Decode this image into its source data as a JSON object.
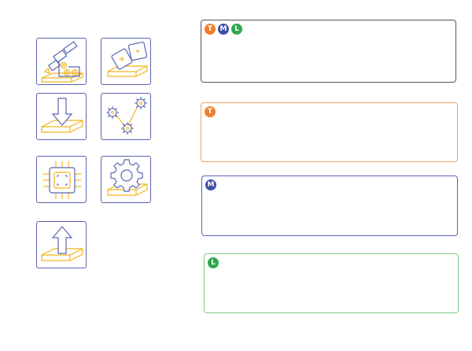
{
  "badges": {
    "t": {
      "letter": "T",
      "color": "#f07d2d"
    },
    "m": {
      "letter": "M",
      "color": "#3e4fa6"
    },
    "l": {
      "letter": "L",
      "color": "#2fa84f"
    }
  },
  "panels": {
    "combined": {
      "border_color": "#555555",
      "badges": [
        "T",
        "M",
        "L"
      ]
    },
    "t": {
      "border_color": "#f0a070"
    },
    "m": {
      "border_color": "#5a64b4"
    },
    "l": {
      "border_color": "#7cc987"
    }
  },
  "icons": [
    {
      "name": "flowchart-tools-icon"
    },
    {
      "name": "add-shapes-icon"
    },
    {
      "name": "import-icon"
    },
    {
      "name": "gear-flow-icon"
    },
    {
      "name": "chip-icon"
    },
    {
      "name": "settings-gear-icon"
    },
    {
      "name": "export-icon"
    }
  ],
  "colors": {
    "icon_stroke": "#5a64b4",
    "icon_accent": "#f2b51c",
    "panel_default": "#555555"
  }
}
